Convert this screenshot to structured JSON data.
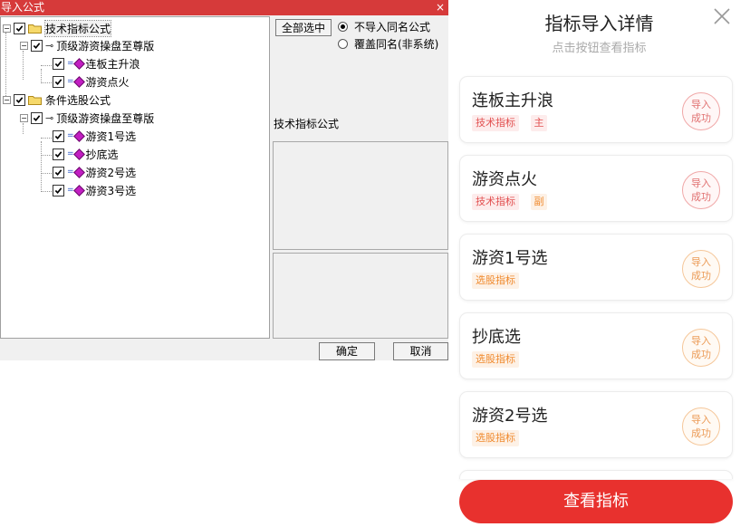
{
  "dialog": {
    "title": "导入公式",
    "close": "×",
    "tree": [
      {
        "label": "技术指标公式"
      },
      {
        "label": "顶级游资操盘至尊版"
      },
      {
        "label": "连板主升浪"
      },
      {
        "label": "游资点火"
      },
      {
        "label": "条件选股公式"
      },
      {
        "label": "顶级游资操盘至尊版"
      },
      {
        "label": "游资1号选"
      },
      {
        "label": "抄底选"
      },
      {
        "label": "游资2号选"
      },
      {
        "label": "游资3号选"
      }
    ],
    "select_all": "全部选中",
    "options": [
      "不导入同名公式",
      "覆盖同名(非系统)"
    ],
    "selected_option": "不导入同名公式",
    "group_label": "技术指标公式",
    "ok": "确定",
    "cancel": "取消"
  },
  "panel": {
    "title": "指标导入详情",
    "subtitle": "点击按钮查看指标",
    "cards": [
      {
        "name": "连板主升浪",
        "tag": "技术指标",
        "role": "主",
        "status_line1": "导入",
        "status_line2": "成功"
      },
      {
        "name": "游资点火",
        "tag": "技术指标",
        "role": "副",
        "status_line1": "导入",
        "status_line2": "成功"
      },
      {
        "name": "游资1号选",
        "tag": "选股指标",
        "status_line1": "导入",
        "status_line2": "成功"
      },
      {
        "name": "抄底选",
        "tag": "选股指标",
        "status_line1": "导入",
        "status_line2": "成功"
      },
      {
        "name": "游资2号选",
        "tag": "选股指标",
        "status_line1": "导入",
        "status_line2": "成功"
      }
    ],
    "view_button": "查看指标"
  },
  "colors": {
    "accent": "#e8312e",
    "dialog_title_bar": "#d63a3a",
    "tag_red": "#e25050",
    "tag_orange": "#f08a2e"
  }
}
